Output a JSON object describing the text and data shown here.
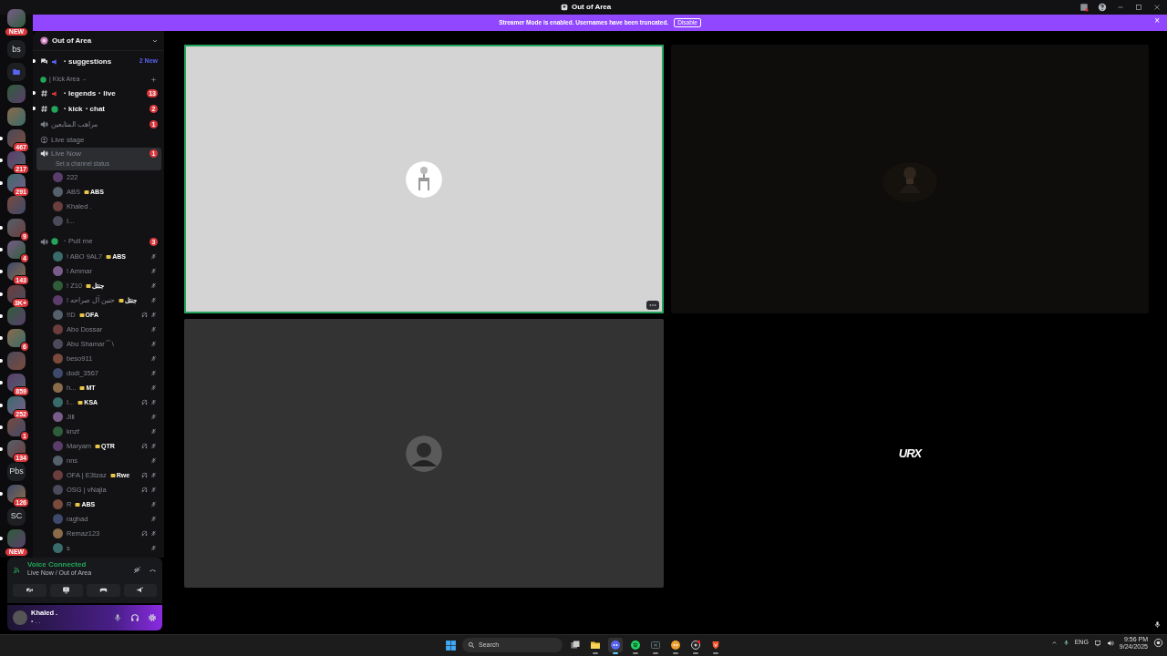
{
  "window": {
    "title": "Out of Area"
  },
  "banner": {
    "text": "Streamer Mode is enabled. Usernames have been truncated.",
    "button": "Disable",
    "close": "×"
  },
  "servers": [
    {
      "kind": "picture",
      "badge": "NEW",
      "unread": false
    },
    {
      "kind": "text",
      "label": "bs",
      "unread": false
    },
    {
      "kind": "folder",
      "unread": false
    },
    {
      "kind": "picture",
      "unread": false
    },
    {
      "kind": "picture",
      "unread": false
    },
    {
      "kind": "picture",
      "badge": "467",
      "unread": true
    },
    {
      "kind": "picture",
      "badge": "217",
      "unread": true
    },
    {
      "kind": "picture",
      "badge": "291",
      "unread": true
    },
    {
      "kind": "picture",
      "unread": false
    },
    {
      "kind": "picture",
      "badge": "9",
      "unread": true
    },
    {
      "kind": "picture",
      "badge": "4",
      "unread": true
    },
    {
      "kind": "picture",
      "badge": "143",
      "unread": true
    },
    {
      "kind": "picture",
      "badge": "3K+",
      "unread": true
    },
    {
      "kind": "picture",
      "unread": true
    },
    {
      "kind": "picture",
      "badge": "6",
      "unread": true
    },
    {
      "kind": "picture",
      "unread": true
    },
    {
      "kind": "picture",
      "badge": "859",
      "unread": true
    },
    {
      "kind": "picture",
      "badge": "252",
      "unread": true
    },
    {
      "kind": "picture",
      "badge": "1",
      "unread": true
    },
    {
      "kind": "picture",
      "badge": "134",
      "unread": true
    },
    {
      "kind": "text",
      "label": "Pbs",
      "unread": false
    },
    {
      "kind": "picture",
      "badge": "126",
      "unread": true
    },
    {
      "kind": "text",
      "label": "SC",
      "unread": false
    },
    {
      "kind": "picture",
      "badge": "NEW",
      "unread": true
    }
  ],
  "guild": {
    "name": "Out of Area"
  },
  "channels": [
    {
      "kind": "forum",
      "name": "・suggestions",
      "unread": true,
      "new": "2 New"
    },
    {
      "kind": "category",
      "name": "| Kick Area"
    },
    {
      "kind": "text",
      "name": "・legends・live",
      "unread": true,
      "badge": "13"
    },
    {
      "kind": "text",
      "name": "・kick・chat",
      "unread": true,
      "badge": "2"
    },
    {
      "kind": "voice",
      "name": "مراهب المتابعين",
      "unread": false,
      "badge": "1",
      "selected": false
    },
    {
      "kind": "stage",
      "name": "Live stage",
      "unread": false
    },
    {
      "kind": "voice",
      "name": "Live Now",
      "unread": false,
      "badge": "1",
      "selected": true,
      "status": "Set a channel status",
      "members": [
        {
          "name": "222",
          "muted": false,
          "deafened": false
        },
        {
          "name": "ABS",
          "tag": "ABS",
          "muted": false,
          "deafened": false
        },
        {
          "name": "Khaled .",
          "muted": false,
          "deafened": false
        },
        {
          "name": "I...",
          "muted": false,
          "deafened": false
        }
      ]
    },
    {
      "kind": "voice",
      "name": "・Pull me",
      "unread": false,
      "badge": "3",
      "selected": false,
      "members": [
        {
          "name": "! ABO 9AL7",
          "tag": "ABS",
          "muted": true,
          "deafened": false
        },
        {
          "name": "! Ammar",
          "muted": true,
          "deafened": false
        },
        {
          "name": "! Z10",
          "tag": "جنتل",
          "muted": true,
          "deafened": false
        },
        {
          "name": "! حنين آل صراحه",
          "tag": "جنتل",
          "muted": true,
          "deafened": false
        },
        {
          "name": "!!D",
          "tag": "OFA",
          "muted": true,
          "deafened": true
        },
        {
          "name": "Abo Dossar",
          "muted": true,
          "deafened": false
        },
        {
          "name": "Abu Shamar⌒\\",
          "muted": true,
          "deafened": false
        },
        {
          "name": "beso911",
          "muted": true,
          "deafened": false
        },
        {
          "name": "dodi_3567",
          "muted": true,
          "deafened": false
        },
        {
          "name": "h...",
          "tag": "MT",
          "muted": true,
          "deafened": false
        },
        {
          "name": "I...",
          "tag": "KSA",
          "muted": true,
          "deafened": true
        },
        {
          "name": "Jill",
          "muted": true,
          "deafened": false
        },
        {
          "name": "knzf",
          "muted": true,
          "deafened": false
        },
        {
          "name": "Maryam",
          "tag": "QTR",
          "muted": true,
          "deafened": true
        },
        {
          "name": "nns",
          "muted": true,
          "deafened": false
        },
        {
          "name": "OFA | E3tzaz",
          "tag": "Rwe",
          "muted": true,
          "deafened": true
        },
        {
          "name": "OSG | vNajla",
          "muted": true,
          "deafened": true
        },
        {
          "name": "R",
          "tag": "ABS",
          "muted": true,
          "deafened": false
        },
        {
          "name": "raghad",
          "muted": true,
          "deafened": false
        },
        {
          "name": "Remaz123",
          "muted": true,
          "deafened": true
        },
        {
          "name": "s",
          "muted": true,
          "deafened": false
        }
      ]
    }
  ],
  "voice_panel": {
    "status": "Voice Connected",
    "location": "Live Now / Out of Area"
  },
  "user_panel": {
    "name": "Khaled .",
    "status": "• . ."
  },
  "tiles": [
    {
      "kind": "avatar",
      "speaking": true
    },
    {
      "kind": "video",
      "speaking": false
    },
    {
      "kind": "avatar",
      "speaking": false
    },
    {
      "kind": "logo",
      "speaking": false,
      "logo": "URX"
    }
  ],
  "taskbar": {
    "search": "Search",
    "apps": [
      {
        "kind": "taskview",
        "active": false
      },
      {
        "kind": "folder",
        "active": false
      },
      {
        "kind": "chat",
        "active": true
      },
      {
        "kind": "music",
        "active": false
      },
      {
        "kind": "game",
        "active": false
      },
      {
        "kind": "chat2",
        "active": false
      },
      {
        "kind": "record",
        "active": false
      },
      {
        "kind": "browser",
        "active": false
      }
    ],
    "language": "ENG",
    "time": "9:56 PM",
    "date": "9/24/2025"
  }
}
